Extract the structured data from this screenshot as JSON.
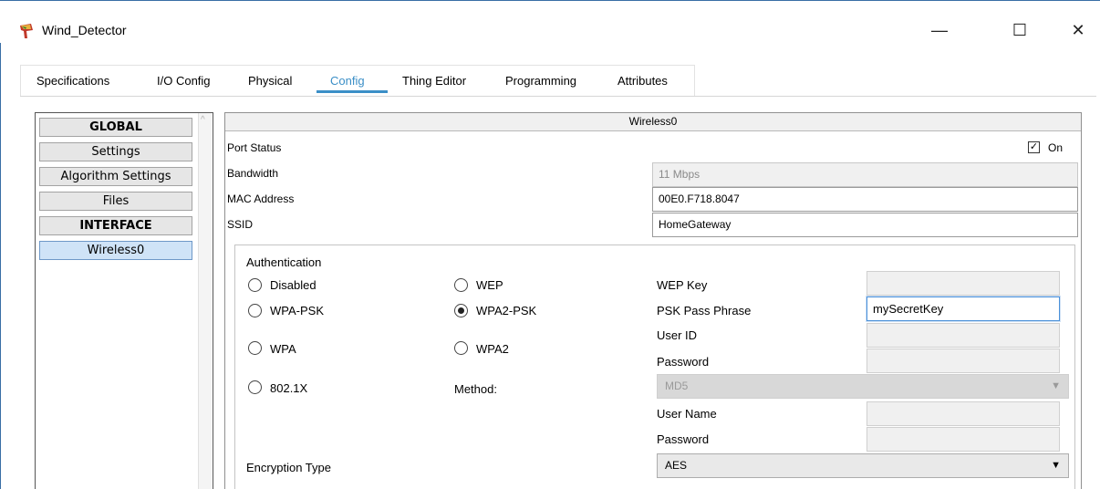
{
  "window": {
    "title": "Wind_Detector",
    "controls": {
      "minimize": "—",
      "maximize": "☐",
      "close": "✕"
    }
  },
  "tabs": [
    {
      "label": "Specifications",
      "active": false
    },
    {
      "label": "I/O Config",
      "active": false
    },
    {
      "label": "Physical",
      "active": false
    },
    {
      "label": "Config",
      "active": true
    },
    {
      "label": "Thing Editor",
      "active": false
    },
    {
      "label": "Programming",
      "active": false
    },
    {
      "label": "Attributes",
      "active": false
    }
  ],
  "sidebar": {
    "items": [
      {
        "label": "GLOBAL",
        "type": "header"
      },
      {
        "label": "Settings",
        "type": "item"
      },
      {
        "label": "Algorithm Settings",
        "type": "item"
      },
      {
        "label": "Files",
        "type": "item"
      },
      {
        "label": "INTERFACE",
        "type": "header"
      },
      {
        "label": "Wireless0",
        "type": "item",
        "selected": true
      }
    ]
  },
  "panel": {
    "title": "Wireless0",
    "port_status": {
      "label": "Port Status",
      "checked": true,
      "on_label": "On"
    },
    "bandwidth": {
      "label": "Bandwidth",
      "value": "11 Mbps"
    },
    "mac_address": {
      "label": "MAC Address",
      "value": "00E0.F718.8047"
    },
    "ssid": {
      "label": "SSID",
      "value": "HomeGateway"
    },
    "authentication": {
      "label": "Authentication",
      "options": {
        "disabled": "Disabled",
        "wep": "WEP",
        "wpa_psk": "WPA-PSK",
        "wpa2_psk": "WPA2-PSK",
        "wpa": "WPA",
        "wpa2": "WPA2",
        "dot1x": "802.1X"
      },
      "selected": "WPA2-PSK",
      "wep_key": {
        "label": "WEP Key",
        "value": ""
      },
      "psk_pass_phrase": {
        "label": "PSK Pass Phrase",
        "value": "mySecretKey"
      },
      "user_id": {
        "label": "User ID",
        "value": ""
      },
      "password": {
        "label": "Password",
        "value": ""
      },
      "method": {
        "label": "Method:",
        "value": "MD5"
      },
      "user_name": {
        "label": "User Name",
        "value": ""
      },
      "password2": {
        "label": "Password",
        "value": ""
      }
    },
    "encryption": {
      "label": "Encryption Type",
      "value": "AES"
    }
  },
  "colors": {
    "accent": "#3b8fc7",
    "window_border": "#3a6ea5",
    "selected_item": "#cfe3f7"
  }
}
